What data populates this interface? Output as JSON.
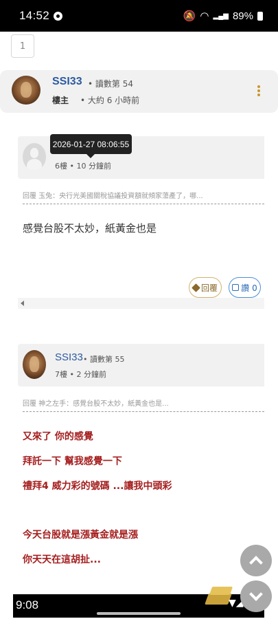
{
  "status_bar": {
    "time": "14:52",
    "battery": "89%"
  },
  "pagination": {
    "current": "1"
  },
  "op": {
    "username": "SSI33",
    "reads": "• 讀數第 54",
    "role": "樓主",
    "time": "• 大約 6 小時前"
  },
  "posts": [
    {
      "tooltip": "2026-01-27 08:06:55",
      "floor_time": "6樓 • 10 分鐘前",
      "quote": "回覆 玉兔：央行光美國關稅協議投資額就傾家蕩產了，哪...",
      "body": "感覺台股不太妙，紙黃金也是",
      "reply_label": "回覆",
      "like_label": "讚 0"
    },
    {
      "username": "SSI33",
      "reads": "• 讀數第 55",
      "floor_time": "7樓 • 2 分鐘前",
      "quote": "回覆 神之左手：感覺台股不太妙，紙黃金也是...",
      "lines": [
        "又來了 你的感覺",
        "拜託一下 幫我感覺一下",
        "禮拜4 威力彩的號碼 ...讓我中頭彩",
        "今天台股就是漲黃金就是漲",
        "你天天在這胡扯..."
      ]
    }
  ],
  "nav_bar": {
    "time": "9:08"
  }
}
